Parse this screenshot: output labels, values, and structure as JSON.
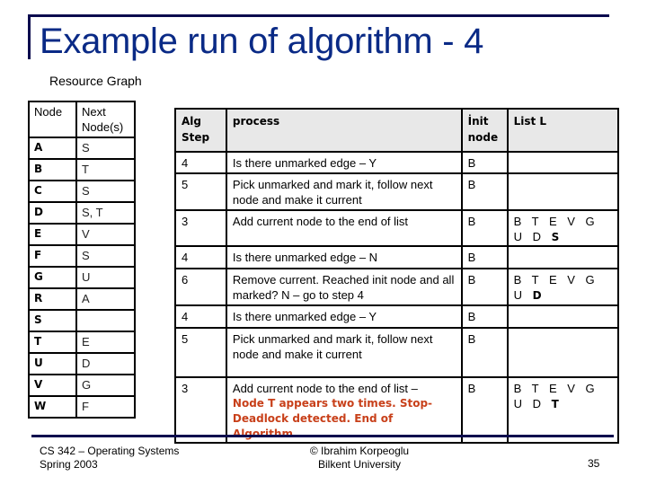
{
  "slide": {
    "title": "Example run of algorithm - 4",
    "subtitle": "Resource Graph"
  },
  "resource_graph": {
    "headers": {
      "node": "Node",
      "next": "Next Node(s)"
    },
    "rows": [
      {
        "node": "A",
        "next": "S"
      },
      {
        "node": "B",
        "next": "T"
      },
      {
        "node": "C",
        "next": "S"
      },
      {
        "node": "D",
        "next": "S, T"
      },
      {
        "node": "E",
        "next": "V"
      },
      {
        "node": "F",
        "next": "S"
      },
      {
        "node": "G",
        "next": "U"
      },
      {
        "node": "R",
        "next": "A"
      },
      {
        "node": "S",
        "next": ""
      },
      {
        "node": "T",
        "next": "E"
      },
      {
        "node": "U",
        "next": "D"
      },
      {
        "node": "V",
        "next": "G"
      },
      {
        "node": "W",
        "next": "F"
      }
    ]
  },
  "algorithm_table": {
    "headers": {
      "step": "Alg Step",
      "process": "process",
      "init": "İnit node",
      "list": "List L"
    },
    "rows": [
      {
        "step": "4",
        "process": "Is there  unmarked edge – Y",
        "alert": "",
        "init": "B",
        "list_prefix": "",
        "list_bold": ""
      },
      {
        "step": "5",
        "process": "Pick unmarked and mark it, follow next node and make it current",
        "alert": "",
        "init": "B",
        "list_prefix": "",
        "list_bold": ""
      },
      {
        "step": "3",
        "process": "Add current node to the end of  list",
        "alert": "",
        "init": "B",
        "list_prefix": "B T E V G U D ",
        "list_bold": "S"
      },
      {
        "step": "4",
        "process": "Is there  unmarked edge – N",
        "alert": "",
        "init": "B",
        "list_prefix": "",
        "list_bold": ""
      },
      {
        "step": "6",
        "process": "Remove current. Reached init node and all marked? N – go to step 4",
        "alert": "",
        "init": "B",
        "list_prefix": "B T E V G U ",
        "list_bold": "D"
      },
      {
        "step": "4",
        "process": "Is there  unmarked edge – Y",
        "alert": "",
        "init": "B",
        "list_prefix": "",
        "list_bold": ""
      },
      {
        "step": "5",
        "process": "Pick unmarked and mark it, follow next node and make it current",
        "alert": "",
        "init": "B",
        "list_prefix": "",
        "list_bold": ""
      },
      {
        "step": "3",
        "process": "Add current node to the end of  list –",
        "alert": "Node T appears two times. Stop-Deadlock detected. End of Algorithm",
        "init": "B",
        "list_prefix": "B T E V G U D ",
        "list_bold": "T"
      }
    ]
  },
  "footer": {
    "course": "CS 342 – Operating Systems",
    "term": "Spring 2003",
    "author": "© Ibrahim Korpeoglu",
    "institution": "Bilkent University",
    "page_number": "35"
  },
  "colors": {
    "title": "#0a2a86",
    "frame": "#0b0b4e",
    "alert": "#c8401a",
    "header_bg": "#e8e8e8"
  }
}
